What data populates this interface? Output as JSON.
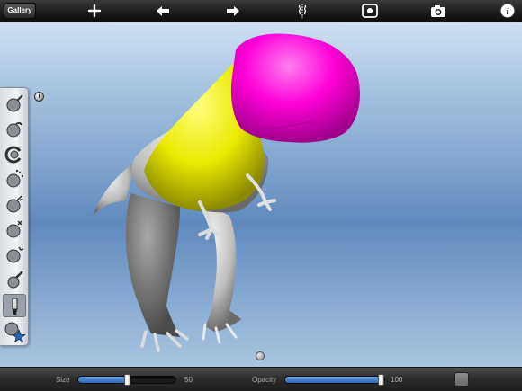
{
  "toolbar": {
    "gallery_label": "Gallery",
    "icons": [
      "add-icon",
      "undo-icon",
      "redo-icon",
      "symmetry-icon",
      "view-reset-icon",
      "camera-icon",
      "info-icon"
    ]
  },
  "palette": {
    "tools": [
      "draw",
      "flatten",
      "grab",
      "smooth",
      "pinch",
      "inflate",
      "crease",
      "layer",
      "paint",
      "stamp"
    ],
    "selected": "paint"
  },
  "model": {
    "paint_colors": {
      "head": "#ff00cc",
      "torso": "#f0f000",
      "skin": "#8c8c8c",
      "base": "#d8d8d8"
    }
  },
  "info_marker": "i",
  "bottom": {
    "size_label": "Size",
    "size_value": "50",
    "size_level": 0.5,
    "opacity_label": "Opacity",
    "opacity_value": "100",
    "opacity_level": 1.0,
    "accent": "#3a7ad0"
  }
}
